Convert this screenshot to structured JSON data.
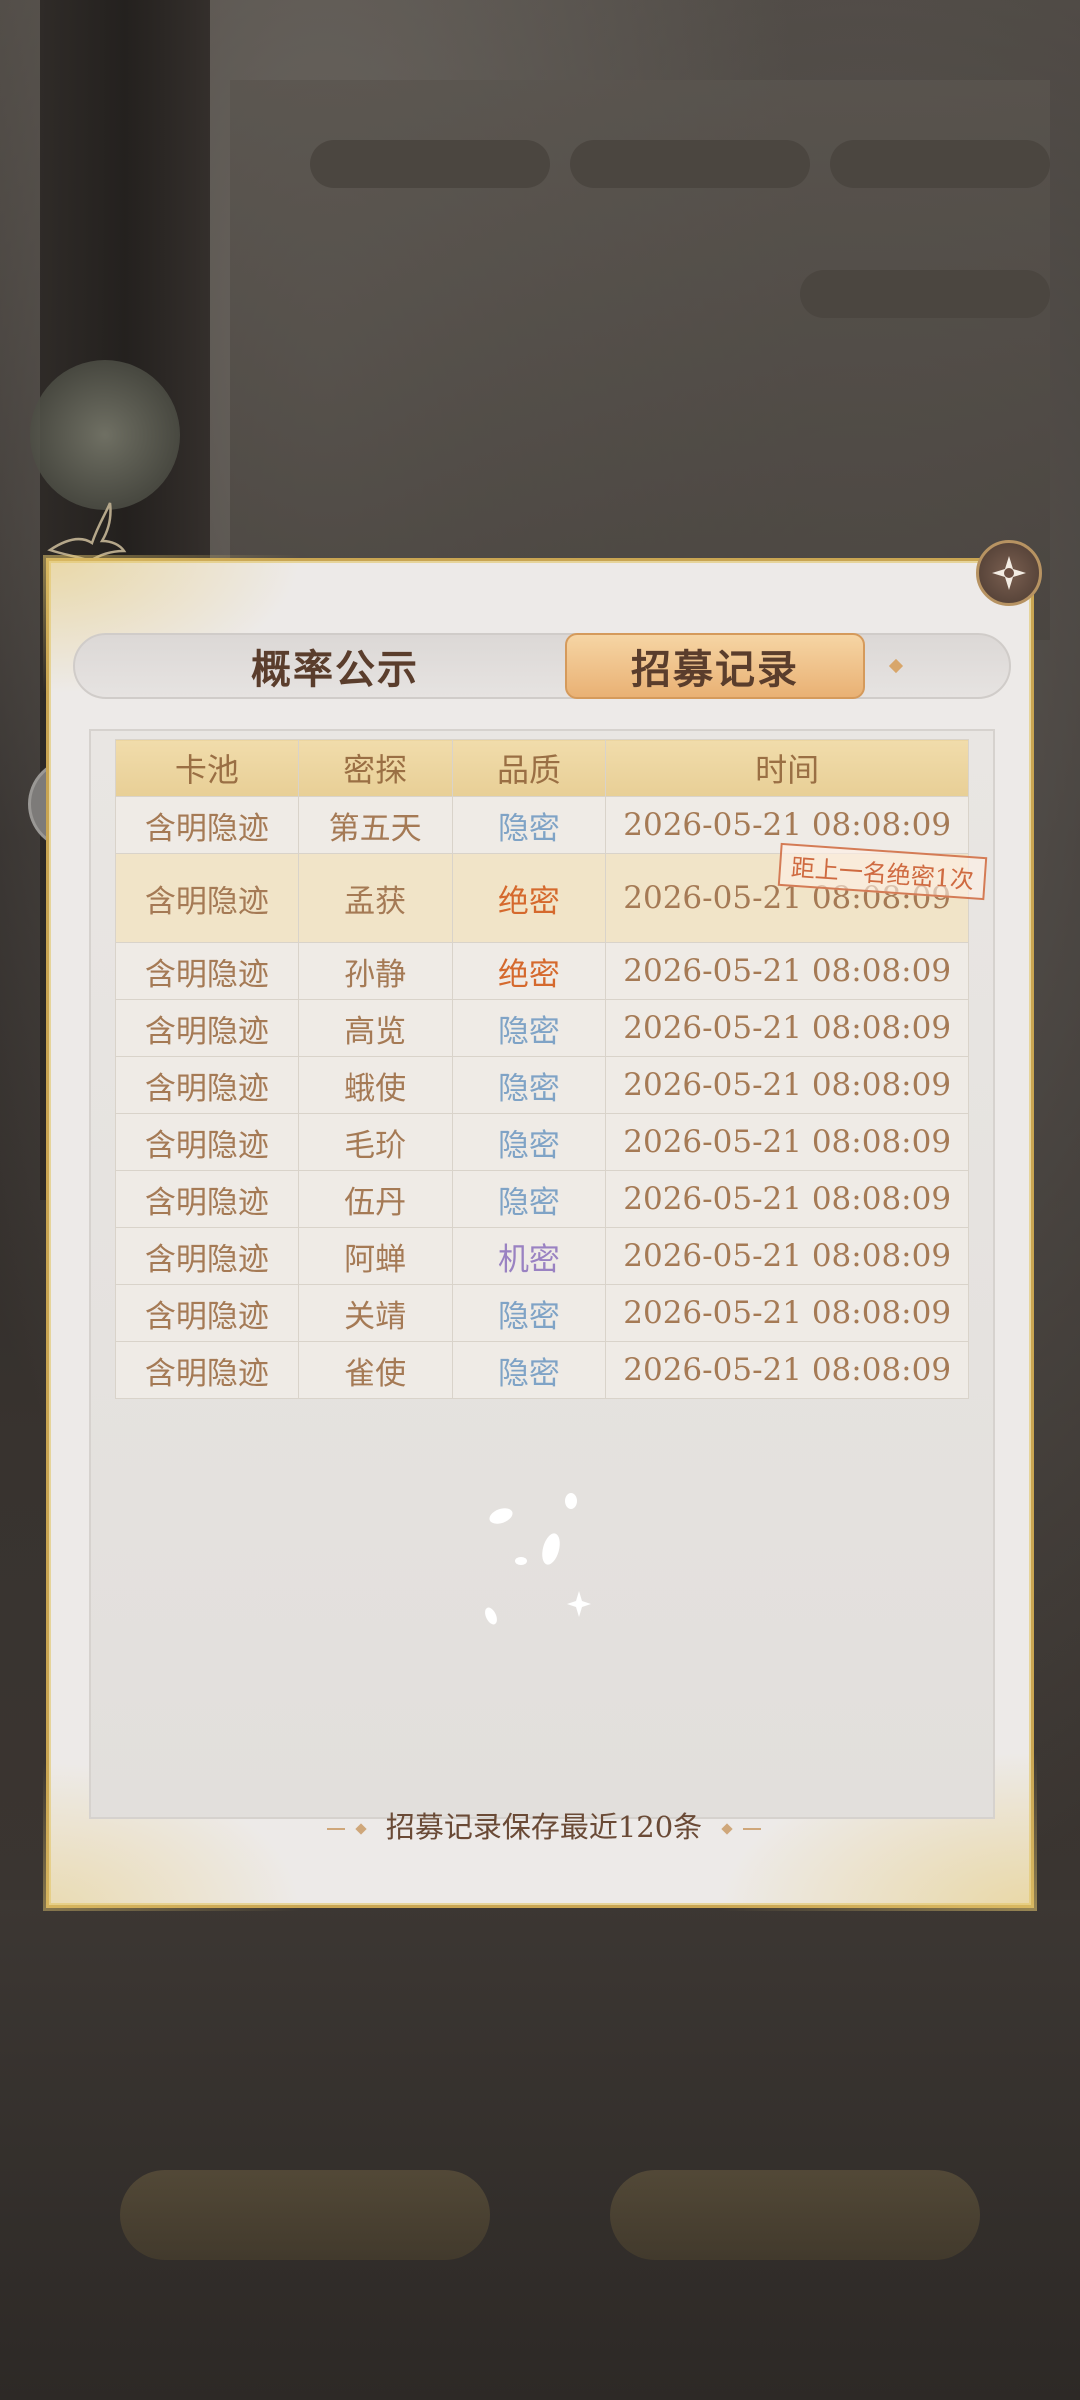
{
  "tabs": [
    {
      "label": "概率公示"
    },
    {
      "label": "招募记录"
    }
  ],
  "table": {
    "headers": [
      "卡池",
      "密探",
      "品质",
      "时间"
    ],
    "rows": [
      {
        "pool": "含明隐迹",
        "agent": "第五天",
        "quality": "隐密",
        "time": "2026-05-21 08:08:09"
      },
      {
        "pool": "含明隐迹",
        "agent": "孟获",
        "quality": "绝密",
        "time": "2026-05-21 08:08:09",
        "stamp": "距上一名绝密1次"
      },
      {
        "pool": "含明隐迹",
        "agent": "孙静",
        "quality": "绝密",
        "time": "2026-05-21 08:08:09"
      },
      {
        "pool": "含明隐迹",
        "agent": "高览",
        "quality": "隐密",
        "time": "2026-05-21 08:08:09"
      },
      {
        "pool": "含明隐迹",
        "agent": "蛾使",
        "quality": "隐密",
        "time": "2026-05-21 08:08:09"
      },
      {
        "pool": "含明隐迹",
        "agent": "毛玠",
        "quality": "隐密",
        "time": "2026-05-21 08:08:09"
      },
      {
        "pool": "含明隐迹",
        "agent": "伍丹",
        "quality": "隐密",
        "time": "2026-05-21 08:08:09"
      },
      {
        "pool": "含明隐迹",
        "agent": "阿蝉",
        "quality": "机密",
        "time": "2026-05-21 08:08:09"
      },
      {
        "pool": "含明隐迹",
        "agent": "关靖",
        "quality": "隐密",
        "time": "2026-05-21 08:08:09"
      },
      {
        "pool": "含明隐迹",
        "agent": "雀使",
        "quality": "隐密",
        "time": "2026-05-21 08:08:09"
      }
    ]
  },
  "footer": {
    "note": "招募记录保存最近120条"
  },
  "icons": {
    "close": "close-icon",
    "share": "share-icon",
    "bird": "bird-ornament-icon"
  },
  "colors": {
    "hidden": "#7fa3c6",
    "top_secret": "#d5692d",
    "secret": "#9a82c2",
    "accent_gold": "#c9a552"
  }
}
